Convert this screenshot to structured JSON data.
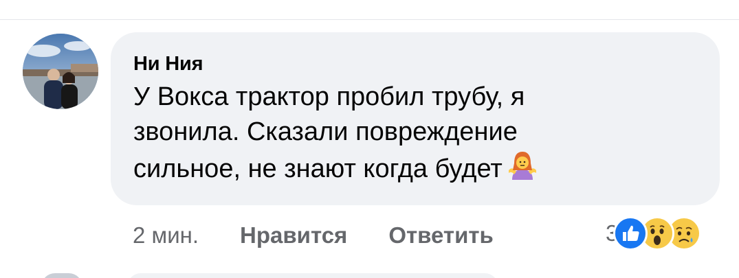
{
  "comment": {
    "author": "Ни Ния",
    "text": "У Вокса трактор пробил трубу, я звонила. Сказали повреждение сильное, не знают когда будет",
    "inline_emoji": "person-shrugging-emoji",
    "avatar": "user-avatar-photo"
  },
  "actions": {
    "time": "2 мин.",
    "like_label": "Нравится",
    "reply_label": "Ответить"
  },
  "reactions": {
    "count": "3",
    "icons": [
      "like-reaction-icon",
      "wow-reaction-icon",
      "sad-reaction-icon"
    ]
  },
  "colors": {
    "bubble": "#f0f2f5",
    "text": "#050505",
    "secondary_text": "#65676b",
    "like_blue": "#1877f2",
    "reaction_yellow": "#f7c948"
  }
}
